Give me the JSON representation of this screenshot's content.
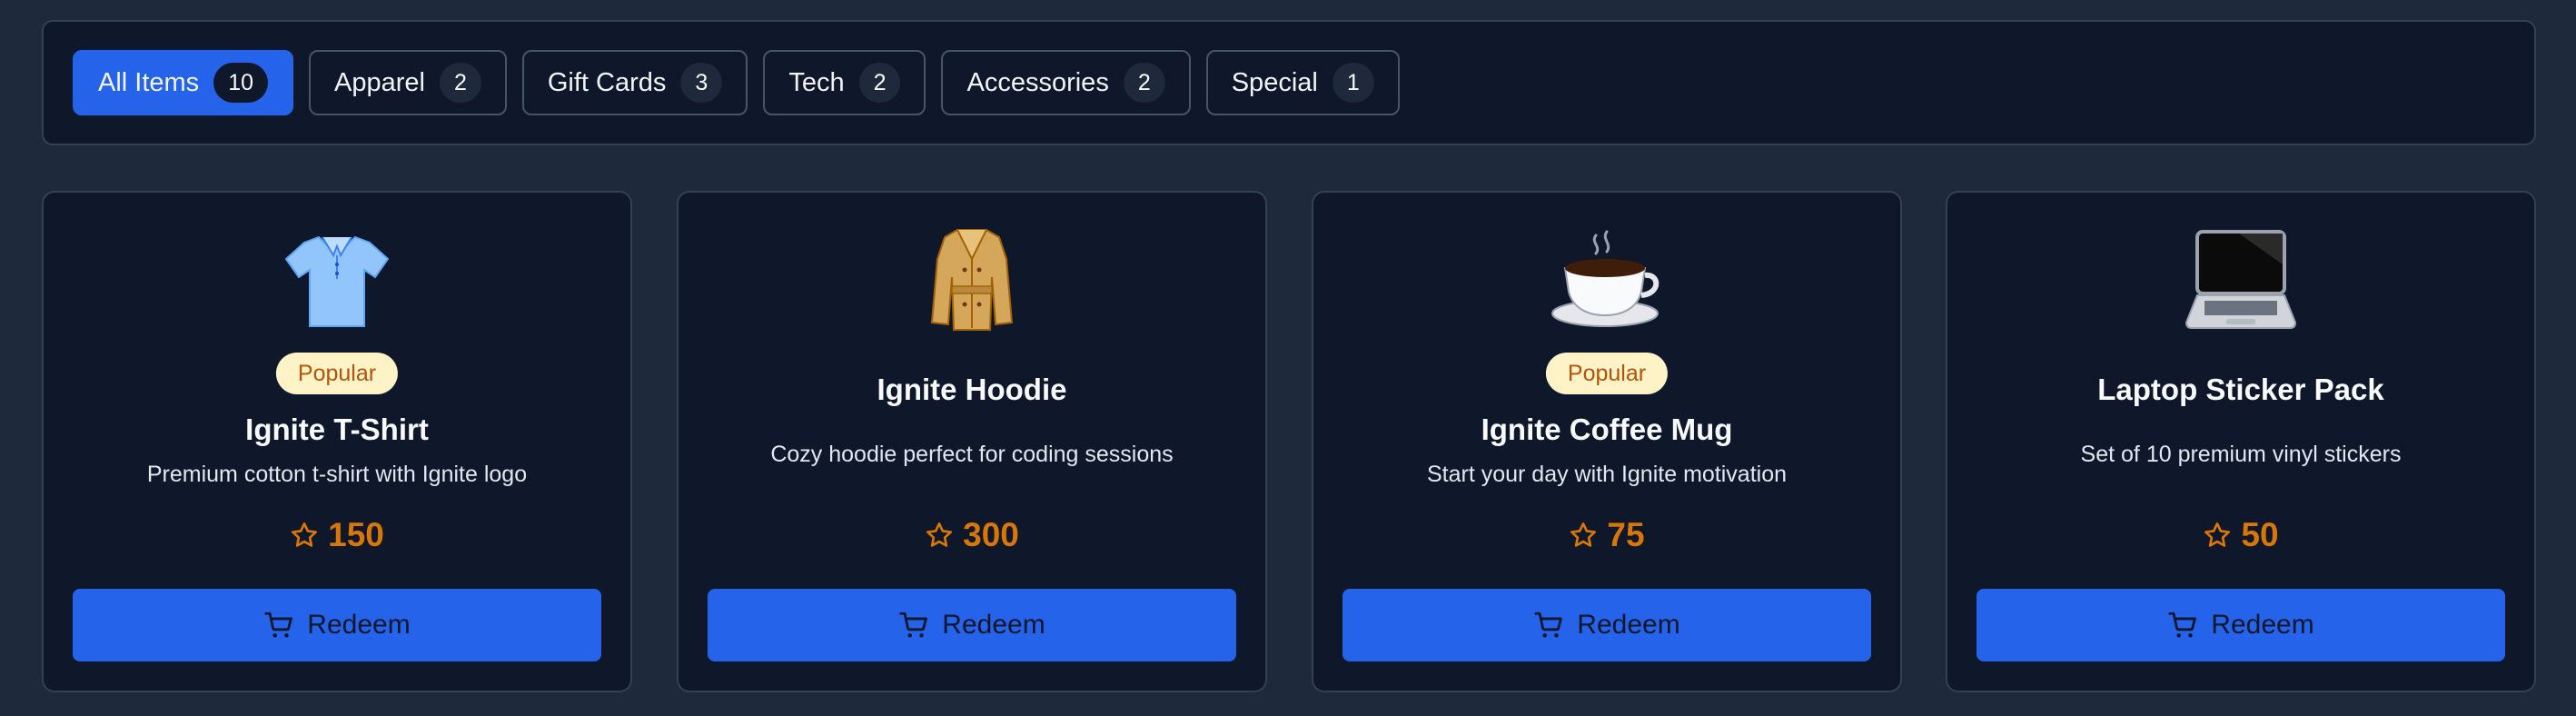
{
  "filters": [
    {
      "label": "All Items",
      "count": "10"
    },
    {
      "label": "Apparel",
      "count": "2"
    },
    {
      "label": "Gift Cards",
      "count": "3"
    },
    {
      "label": "Tech",
      "count": "2"
    },
    {
      "label": "Accessories",
      "count": "2"
    },
    {
      "label": "Special",
      "count": "1"
    }
  ],
  "active_filter": "All Items",
  "redeem_label": "Redeem",
  "products": [
    {
      "title": "Ignite T-Shirt",
      "description": "Premium cotton t-shirt with Ignite logo",
      "price": "150",
      "badge": "Popular",
      "icon": "t-shirt-icon"
    },
    {
      "title": "Ignite Hoodie",
      "description": "Cozy hoodie perfect for coding sessions",
      "price": "300",
      "badge": "",
      "icon": "coat-icon"
    },
    {
      "title": "Ignite Coffee Mug",
      "description": "Start your day with Ignite motivation",
      "price": "75",
      "badge": "Popular",
      "icon": "coffee-icon"
    },
    {
      "title": "Laptop Sticker Pack",
      "description": "Set of 10 premium vinyl stickers",
      "price": "50",
      "badge": "",
      "icon": "laptop-icon"
    }
  ],
  "colors": {
    "background": "#1e293b",
    "panel": "#0f172a",
    "accent": "#2563eb",
    "price": "#d97706",
    "badge_bg": "#fef3c7",
    "badge_text": "#b45309"
  }
}
